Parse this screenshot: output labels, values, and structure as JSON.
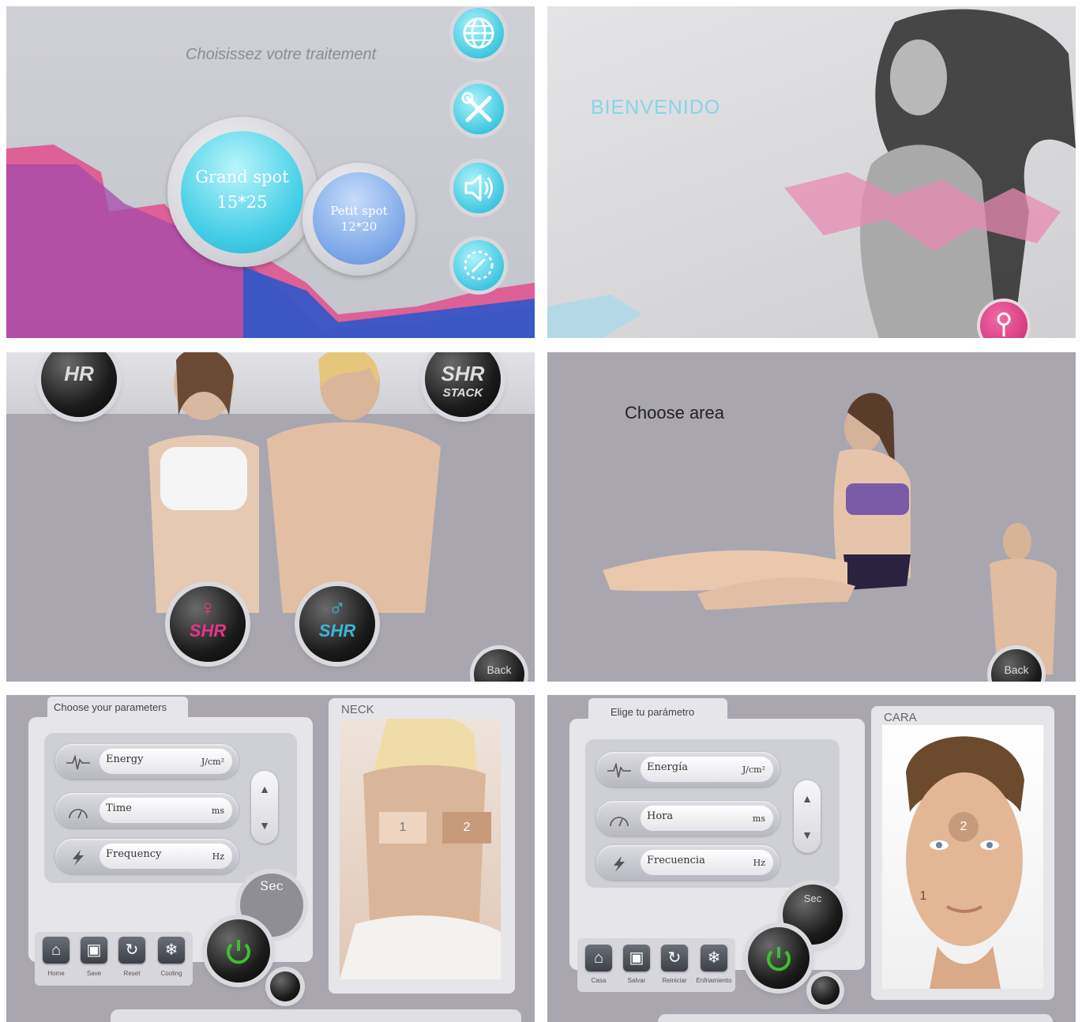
{
  "panel1": {
    "title": "Choisissez votre traitement",
    "grand_label": "Grand spot",
    "grand_size": "15*25",
    "petit_label": "Petit spot",
    "petit_size": "12*20",
    "icons": [
      "globe-icon",
      "tools-icon",
      "speaker-icon",
      "sun-icon"
    ]
  },
  "panel2": {
    "title": "BIENVENIDO",
    "icon": "key-icon"
  },
  "panel3": {
    "hr_label": "HR",
    "shr_label": "SHR",
    "stack_label": "STACK",
    "female_label": "SHR",
    "male_label": "SHR",
    "back_label": "Back"
  },
  "panel4": {
    "title": "Choose area",
    "back_label": "Back"
  },
  "panel5": {
    "tab_label": "Choose your parameters",
    "area_label": "NECK",
    "params": [
      {
        "label": "Energy",
        "unit": "J/cm²",
        "icon": "pulse-icon"
      },
      {
        "label": "Time",
        "unit": "ms",
        "icon": "gauge-icon"
      },
      {
        "label": "Frequency",
        "unit": "Hz",
        "icon": "lightning-icon"
      }
    ],
    "sec_label": "Sec",
    "zones": [
      "1",
      "2"
    ],
    "controls": [
      {
        "label": "Home",
        "icon": "home-icon"
      },
      {
        "label": "Save",
        "icon": "save-icon"
      },
      {
        "label": "Reset",
        "icon": "reset-icon"
      },
      {
        "label": "Cooling",
        "icon": "snowflake-icon"
      }
    ]
  },
  "panel6": {
    "tab_label": "Elige tu parámetro",
    "area_label": "CARA",
    "params": [
      {
        "label": "Energía",
        "unit": "J/cm²",
        "icon": "pulse-icon"
      },
      {
        "label": "Hora",
        "unit": "ms",
        "icon": "gauge-icon"
      },
      {
        "label": "Frecuencia",
        "unit": "Hz",
        "icon": "lightning-icon"
      }
    ],
    "sec_label": "Sec",
    "zones": [
      "1",
      "2"
    ],
    "controls": [
      {
        "label": "Casa",
        "icon": "home-icon"
      },
      {
        "label": "Salvar",
        "icon": "save-icon"
      },
      {
        "label": "Reiniciar",
        "icon": "reset-icon"
      },
      {
        "label": "Enfriamiento",
        "icon": "snowflake-icon"
      }
    ]
  },
  "colors": {
    "panel_gray": "#a9a6b0",
    "light_gray": "#d2d2d8",
    "cyan": "#41c7e0",
    "pink": "#e8348a",
    "blue_ribbon": "#2f58c8",
    "power_green": "#3fbf2f"
  }
}
